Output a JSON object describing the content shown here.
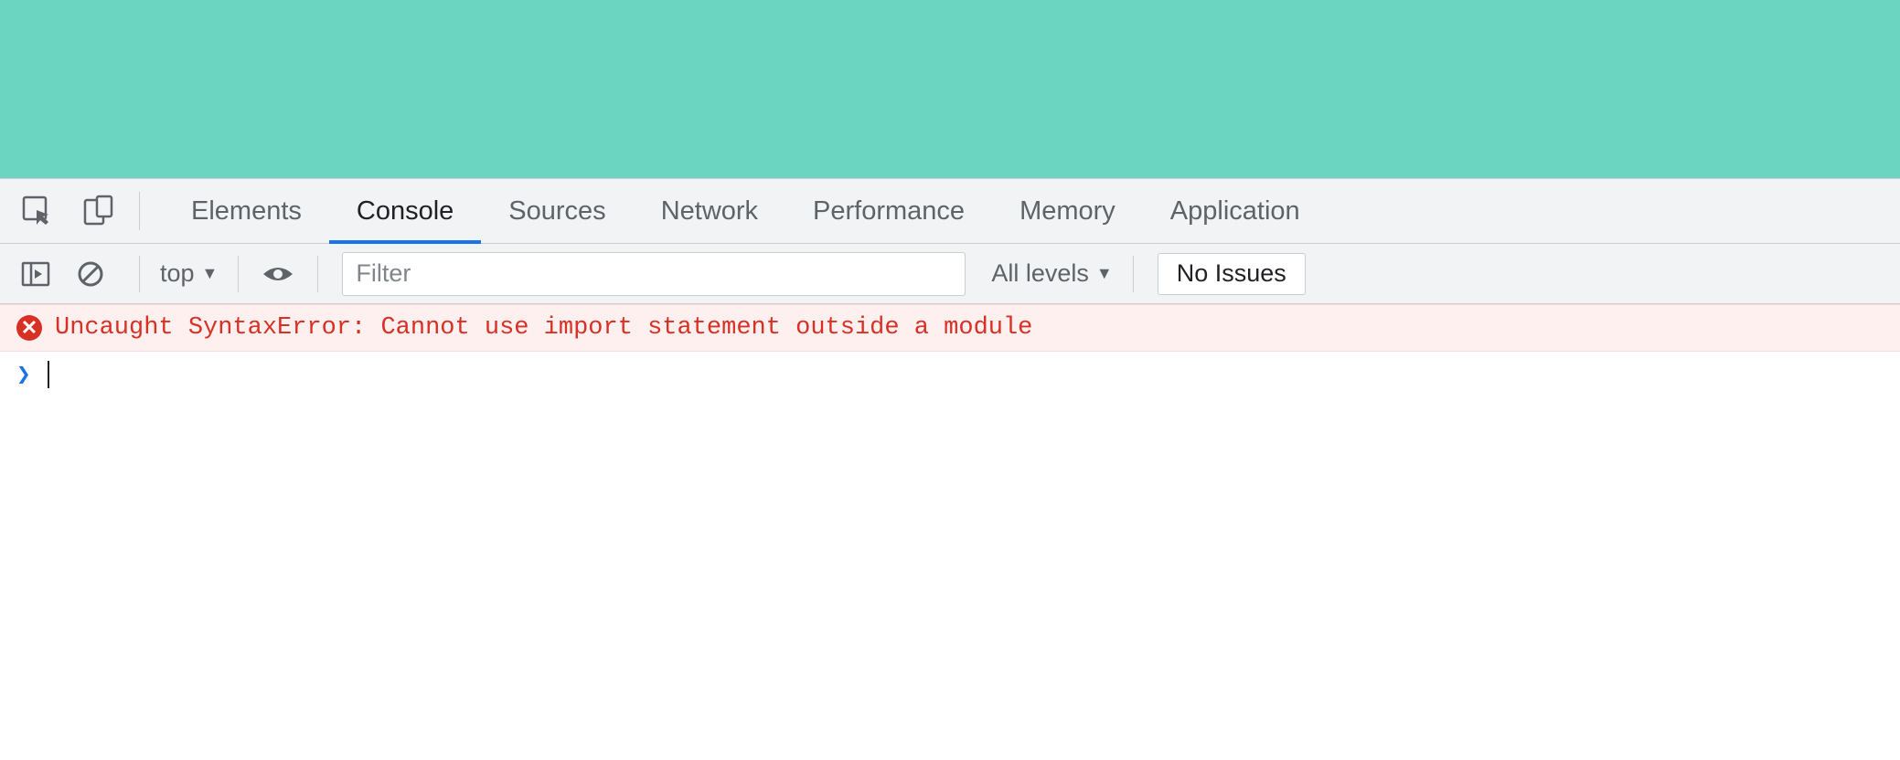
{
  "tabs": {
    "items": [
      {
        "label": "Elements"
      },
      {
        "label": "Console"
      },
      {
        "label": "Sources"
      },
      {
        "label": "Network"
      },
      {
        "label": "Performance"
      },
      {
        "label": "Memory"
      },
      {
        "label": "Application"
      }
    ],
    "active_index": 1
  },
  "toolbar": {
    "context_label": "top",
    "filter_placeholder": "Filter",
    "levels_label": "All levels",
    "issues_label": "No Issues"
  },
  "console": {
    "error_message": "Uncaught SyntaxError: Cannot use import statement outside a module",
    "prompt_symbol": "❯"
  },
  "colors": {
    "page_bg": "#6cd5c1",
    "error_text": "#d93025",
    "active_tab_underline": "#1a73e8"
  }
}
